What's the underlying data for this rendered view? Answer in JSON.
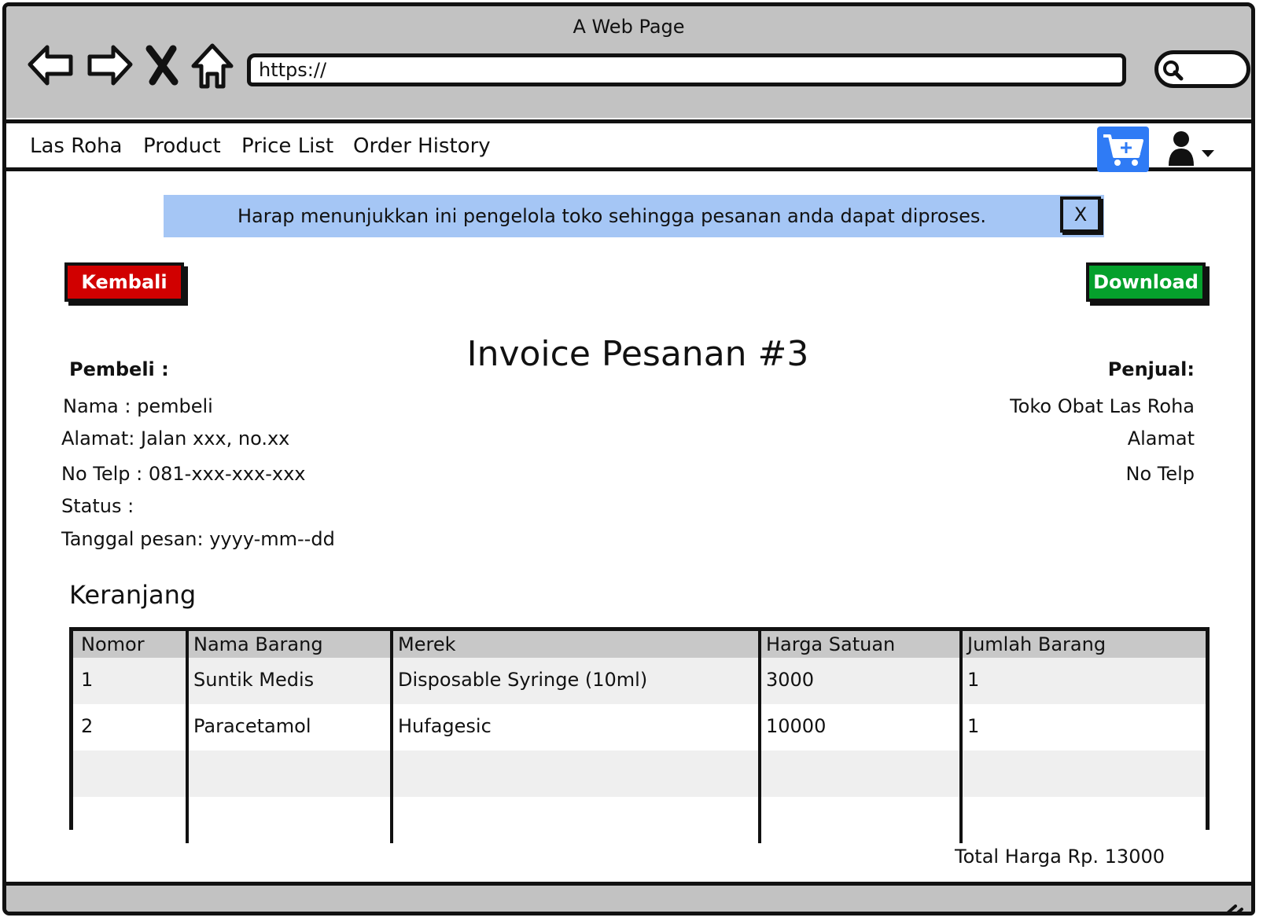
{
  "window": {
    "title": "A Web Page"
  },
  "browser": {
    "url": "https://"
  },
  "nav": {
    "items": [
      "Las Roha",
      "Product",
      "Price List",
      "Order History"
    ]
  },
  "alert": {
    "message": "Harap menunjukkan ini pengelola toko sehingga pesanan anda dapat diproses.",
    "close_label": "X"
  },
  "actions": {
    "back_label": "Kembali",
    "download_label": "Download"
  },
  "invoice": {
    "title": "Invoice Pesanan #3",
    "buyer": {
      "heading": "Pembeli :",
      "name": "Nama : pembeli",
      "address": "Alamat: Jalan xxx, no.xx",
      "phone": "No Telp : 081-xxx-xxx-xxx",
      "status": "Status :",
      "date": "Tanggal pesan: yyyy-mm--dd"
    },
    "seller": {
      "heading": "Penjual:",
      "name": "Toko Obat Las Roha",
      "address": "Alamat",
      "phone": "No Telp"
    }
  },
  "cart": {
    "title": "Keranjang",
    "columns": [
      "Nomor",
      "Nama Barang",
      "Merek",
      "Harga Satuan",
      "Jumlah Barang"
    ],
    "rows": [
      [
        "1",
        "Suntik Medis",
        "Disposable Syringe (10ml)",
        "3000",
        "1"
      ],
      [
        "2",
        "Paracetamol",
        "Hufagesic",
        "10000",
        "1"
      ],
      [
        "",
        "",
        "",
        "",
        ""
      ],
      [
        "",
        "",
        "",
        "",
        ""
      ]
    ],
    "total": "Total Harga Rp. 13000"
  },
  "colors": {
    "chrome": "#c2c2c2",
    "alert": "#a5c6f5",
    "back_button": "#d10000",
    "download_button": "#05a02c",
    "cart_button": "#2f7bf5"
  },
  "icons": [
    "back-arrow-icon",
    "forward-arrow-icon",
    "stop-icon",
    "home-icon",
    "search-icon",
    "cart-add-icon",
    "user-icon",
    "caret-down-icon",
    "resize-grip-icon"
  ]
}
